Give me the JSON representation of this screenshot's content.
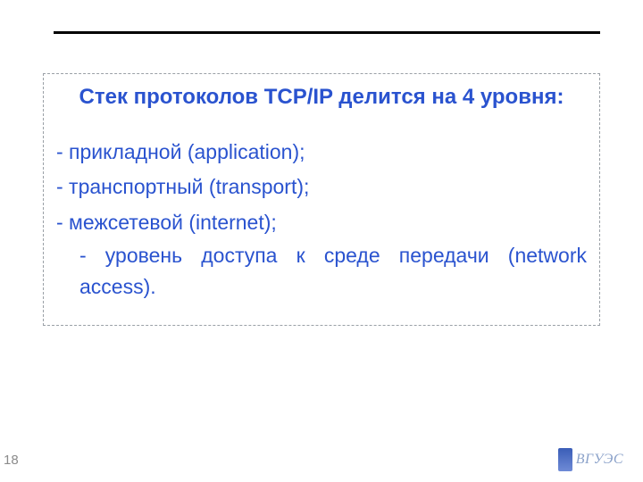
{
  "heading": "Стек протоколов TCP/IP делится на 4 уровня:",
  "items": [
    "- прикладной (application);",
    "- транспортный (transport);",
    "- межсетевой (internet);",
    "- уровень доступа к среде передачи (network access)."
  ],
  "page_number": "18",
  "watermark": "ВГУЭС"
}
